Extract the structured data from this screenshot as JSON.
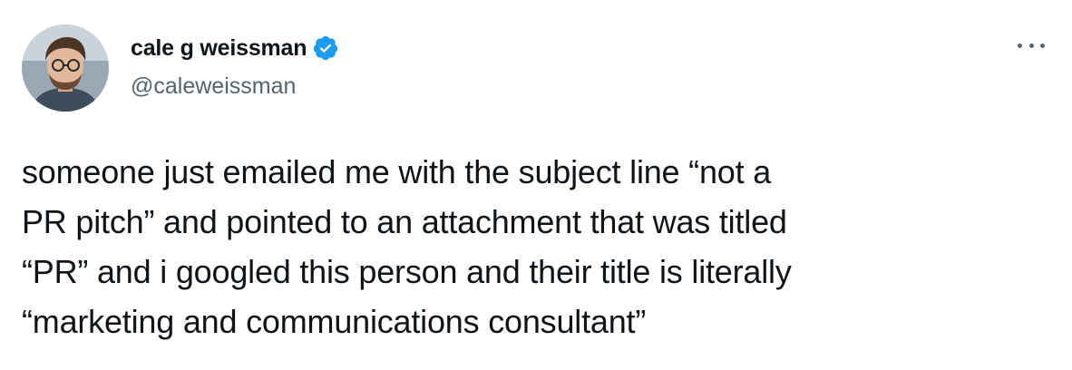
{
  "author": {
    "display_name": "cale g weissman",
    "handle": "@caleweissman",
    "verified": true,
    "avatar_icon": "avatar-photo"
  },
  "menu": {
    "more_icon": "more-horizontal-icon"
  },
  "tweet": {
    "text": "someone just emailed me with the subject line “not a\nPR pitch” and pointed to an attachment that was titled\n“PR” and i googled this person and their title is literally\n“marketing and communications consultant”"
  },
  "colors": {
    "text_primary": "#0f1419",
    "text_secondary": "#536471",
    "verified_blue": "#1d9bf0"
  }
}
